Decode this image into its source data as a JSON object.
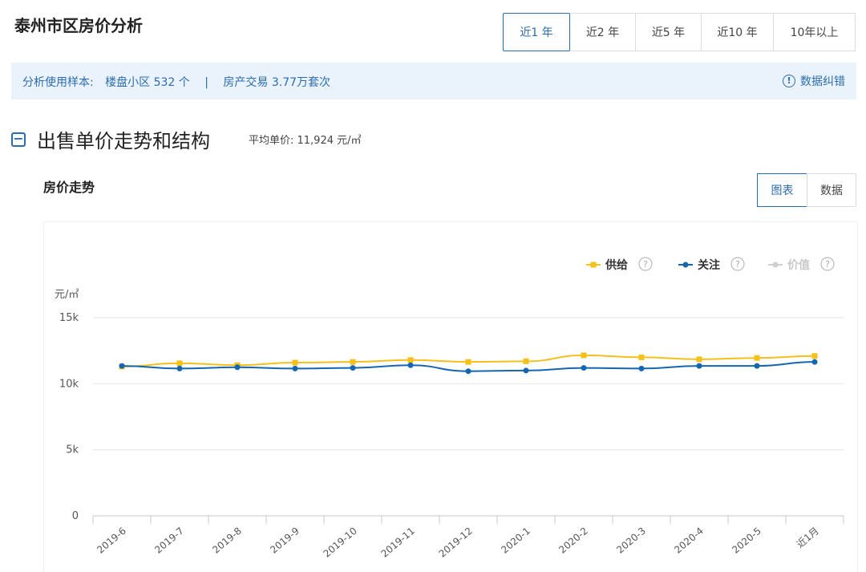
{
  "header": {
    "title": "泰州市区房价分析",
    "tabs": [
      {
        "label": "近1 年",
        "active": true
      },
      {
        "label": "近2 年",
        "active": false
      },
      {
        "label": "近5 年",
        "active": false
      },
      {
        "label": "近10 年",
        "active": false
      },
      {
        "label": "10年以上",
        "active": false
      }
    ]
  },
  "info": {
    "sample_label": "分析使用样本:",
    "communities": "楼盘小区 532 个",
    "separator": "|",
    "transactions": "房产交易 3.77万套次",
    "fix_icon": "!",
    "fix_label": "数据纠错"
  },
  "section": {
    "collapse_icon": "−",
    "title": "出售单价走势和结构",
    "avg_label": "平均单价: 11,924 元/㎡"
  },
  "subsection": {
    "title": "房价走势",
    "view_buttons": [
      {
        "label": "图表",
        "active": true
      },
      {
        "label": "数据",
        "active": false
      }
    ]
  },
  "colors": {
    "accent": "#2b6cb0",
    "supply": "#f5c01a",
    "attention": "#1466b0",
    "value": "#cfcfcf"
  },
  "chart_data": {
    "type": "line",
    "ylabel": "元/㎡",
    "ylim": [
      0,
      15000
    ],
    "yticks": [
      0,
      5000,
      10000,
      15000
    ],
    "ytick_labels": [
      "0",
      "5k",
      "10k",
      "15k"
    ],
    "grid": true,
    "legend_position": "top-right",
    "categories": [
      "2019-6",
      "2019-7",
      "2019-8",
      "2019-9",
      "2019-10",
      "2019-11",
      "2019-12",
      "2020-1",
      "2020-2",
      "2020-3",
      "2020-4",
      "2020-5",
      "近1月"
    ],
    "series": [
      {
        "name": "供给",
        "color": "#f5c01a",
        "marker": "square",
        "enabled": true,
        "values": [
          11300,
          11550,
          11400,
          11600,
          11650,
          11800,
          11650,
          11700,
          12150,
          12000,
          11850,
          11950,
          12100
        ]
      },
      {
        "name": "关注",
        "color": "#1466b0",
        "marker": "circle",
        "enabled": true,
        "values": [
          11350,
          11150,
          11250,
          11150,
          11200,
          11400,
          10950,
          11000,
          11200,
          11150,
          11350,
          11350,
          11650
        ]
      },
      {
        "name": "价值",
        "color": "#cfcfcf",
        "marker": "circle",
        "enabled": false,
        "values": []
      }
    ],
    "legend_help_icon": "?"
  }
}
